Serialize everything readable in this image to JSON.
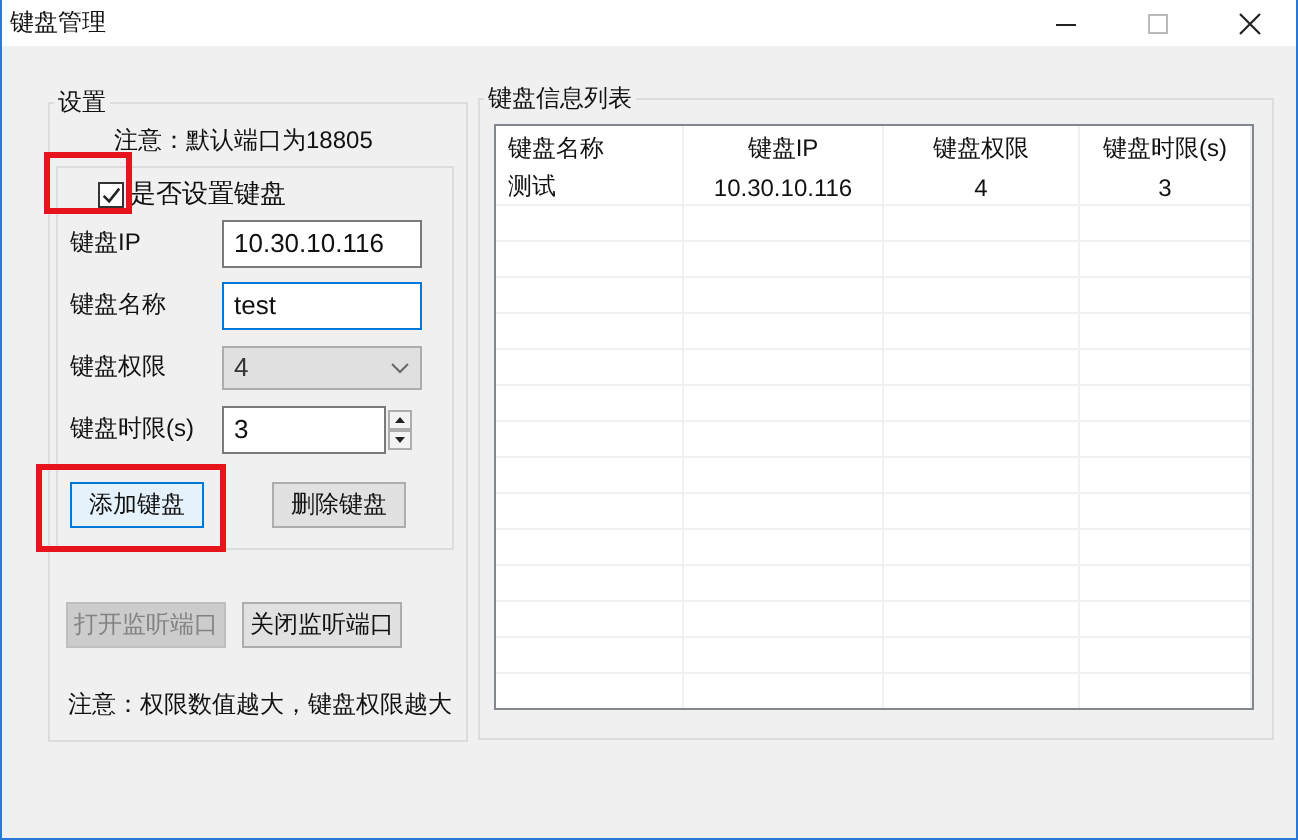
{
  "window": {
    "title": "键盘管理"
  },
  "settings": {
    "title": "设置",
    "port_note": "注意：默认端口为18805",
    "enable_checkbox": {
      "label": "是否设置键盘",
      "checked": true,
      "highlighted": true
    },
    "fields": [
      {
        "kind": "text",
        "label": "键盘IP",
        "value": "10.30.10.116",
        "focused": false
      },
      {
        "kind": "text",
        "label": "键盘名称",
        "value": "test",
        "focused": true
      },
      {
        "kind": "combo",
        "label": "键盘权限",
        "value": "4",
        "disabled": true
      },
      {
        "kind": "spin",
        "label": "键盘时限(s)",
        "value": "3"
      }
    ],
    "keyboard_buttons": [
      {
        "label": "添加键盘",
        "focused": true,
        "highlighted": true
      },
      {
        "label": "删除键盘",
        "focused": false,
        "highlighted": false
      }
    ],
    "port_buttons": [
      {
        "label": "打开监听端口",
        "disabled": true
      },
      {
        "label": "关闭监听端口",
        "disabled": false
      }
    ],
    "footer_note": "注意：权限数值越大，键盘权限越大"
  },
  "list": {
    "title": "键盘信息列表",
    "columns": [
      "键盘名称",
      "键盘IP",
      "键盘权限",
      "键盘时限(s)"
    ],
    "rows": [
      [
        "测试",
        "10.30.10.116",
        "4",
        "3"
      ]
    ]
  }
}
